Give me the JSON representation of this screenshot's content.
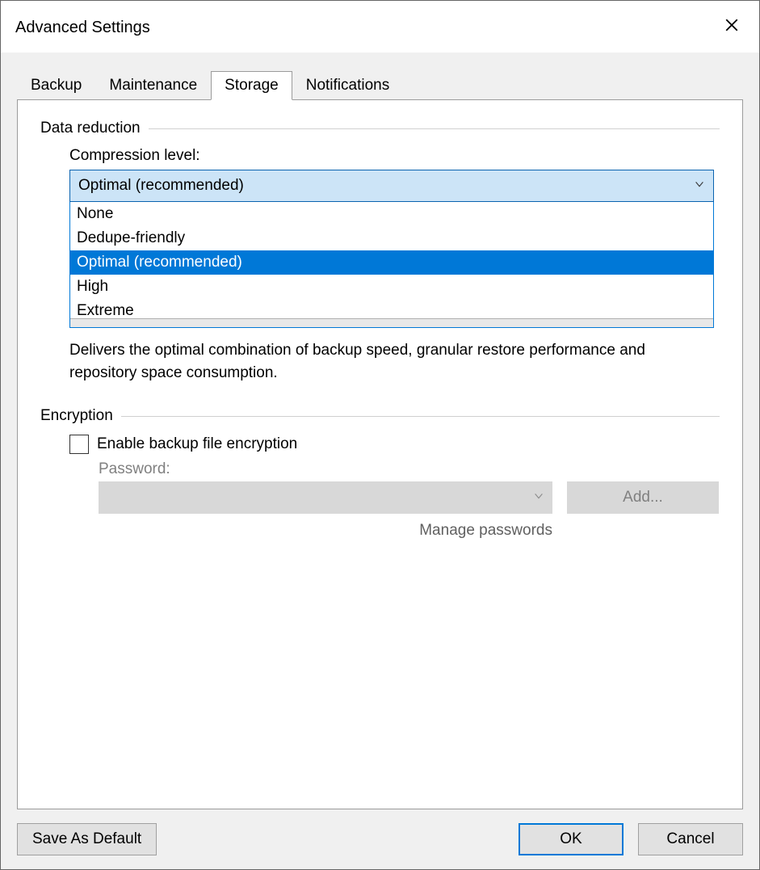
{
  "window": {
    "title": "Advanced Settings"
  },
  "tabs": {
    "t0": "Backup",
    "t1": "Maintenance",
    "t2": "Storage",
    "t3": "Notifications"
  },
  "data_reduction": {
    "group_label": "Data reduction",
    "compression_label": "Compression level:",
    "selected": "Optimal (recommended)",
    "options": {
      "o0": "None",
      "o1": "Dedupe-friendly",
      "o2": "Optimal (recommended)",
      "o3": "High",
      "o4": "Extreme"
    },
    "description": "Delivers the optimal combination of backup speed, granular restore performance and repository space consumption."
  },
  "encryption": {
    "group_label": "Encryption",
    "enable_label": "Enable backup file encryption",
    "password_label": "Password:",
    "add_button": "Add...",
    "manage_link": "Manage passwords"
  },
  "footer": {
    "save_default": "Save As Default",
    "ok": "OK",
    "cancel": "Cancel"
  }
}
